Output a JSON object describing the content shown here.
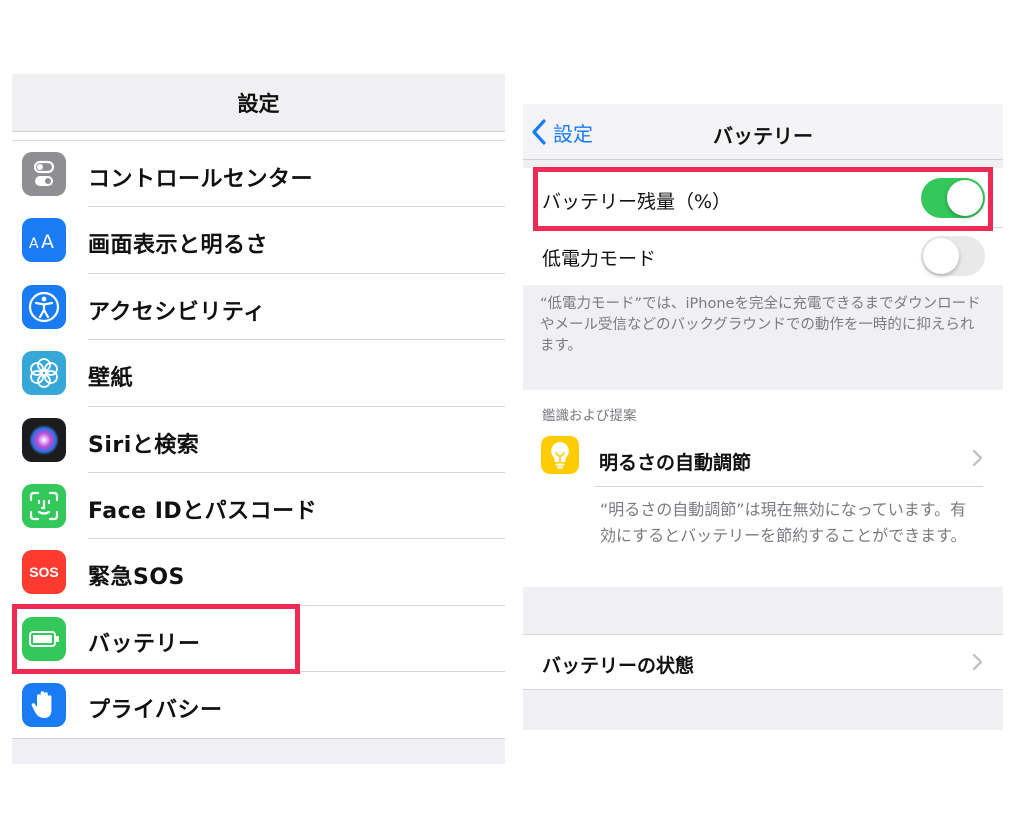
{
  "left": {
    "title": "設定",
    "items": [
      {
        "label": "コントロールセンター",
        "icon": "control-center-icon",
        "color": "#8e8e93"
      },
      {
        "label": "画面表示と明るさ",
        "icon": "display-brightness-icon",
        "color": "#1a7cf5"
      },
      {
        "label": "アクセシビリティ",
        "icon": "accessibility-icon",
        "color": "#1a7cf5"
      },
      {
        "label": "壁紙",
        "icon": "wallpaper-icon",
        "color": "#35a8d8"
      },
      {
        "label": "Siriと検索",
        "icon": "siri-icon",
        "color": "#1c1c1e"
      },
      {
        "label": "Face IDとパスコード",
        "icon": "face-id-icon",
        "color": "#34c759"
      },
      {
        "label": "緊急SOS",
        "icon": "sos-icon",
        "color": "#ff3b30",
        "icon_text": "SOS"
      },
      {
        "label": "バッテリー",
        "icon": "battery-icon",
        "color": "#34c759"
      },
      {
        "label": "プライバシー",
        "icon": "privacy-hand-icon",
        "color": "#1a7cf5"
      }
    ]
  },
  "right": {
    "back_label": "設定",
    "title": "バッテリー",
    "battery_percentage": {
      "label": "バッテリー残量（%）",
      "enabled": true
    },
    "low_power_mode": {
      "label": "低電力モード",
      "enabled": false
    },
    "low_power_footnote": "“低電力モード”では、iPhoneを完全に充電できるまでダウンロードやメール受信などのバックグラウンドでの動作を一時的に抑えられます。",
    "insights_header": "鑑識および提案",
    "auto_brightness": {
      "label": "明るさの自動調節",
      "icon": "lightbulb-icon",
      "color": "#ffcc00"
    },
    "auto_brightness_note": "“明るさの自動調節”は現在無効になっています。有効にするとバッテリーを節約することができます。",
    "battery_health_label": "バッテリーの状態"
  },
  "colors": {
    "accent_blue": "#1a7cf5",
    "toggle_on": "#34c759",
    "highlight_red": "#ee2a55"
  }
}
